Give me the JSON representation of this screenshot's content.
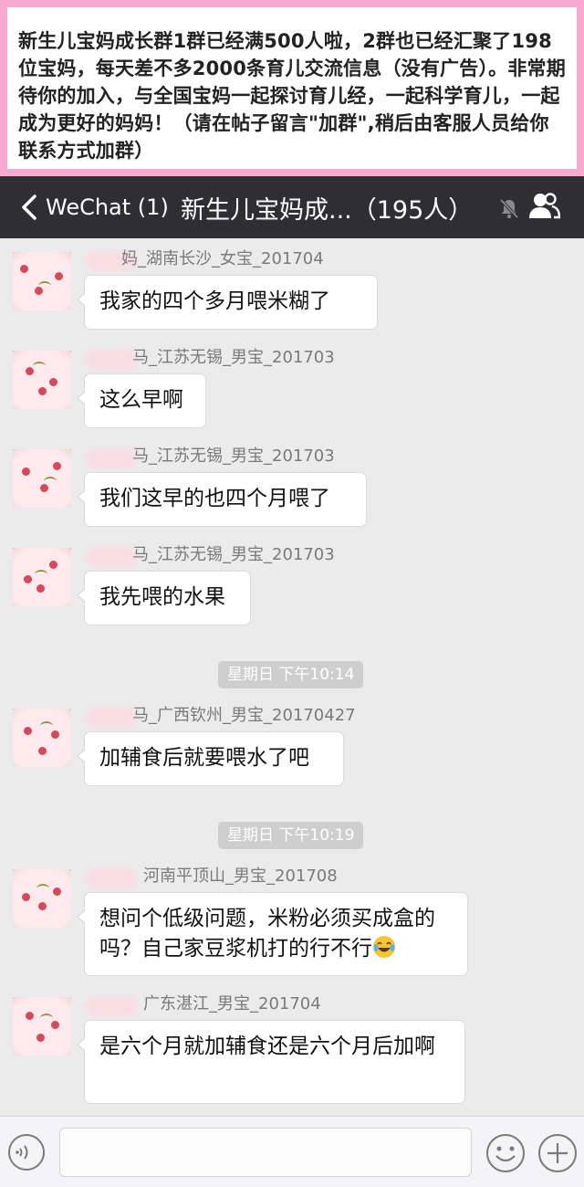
{
  "banner": {
    "text": "新生儿宝妈成长群1群已经满500人啦，2群也已经汇聚了198位宝妈，每天差不多2000条育儿交流信息（没有广告）。非常期待你的加入，与全国宝妈一起探讨育儿经，一起科学育儿，一起成为更好的妈妈！（请在帖子留言\"加群\",稍后由客服人员给你联系方式加群）"
  },
  "navbar": {
    "back_label": "WeChat (1)",
    "title": "新生儿宝妈成...（195人）",
    "mute_icon": "mute-bell-icon",
    "members_icon": "members-icon",
    "background": "#2f2f33"
  },
  "chat": {
    "messages": [
      {
        "sender": "妈_湖南长沙_女宝_201704",
        "text": "我家的四个多月喂米糊了"
      },
      {
        "sender": "马_江苏无锡_男宝_201703",
        "text": "这么早啊"
      },
      {
        "sender": "马_江苏无锡_男宝_201703",
        "text": "我们这早的也四个月喂了"
      },
      {
        "sender": "马_江苏无锡_男宝_201703",
        "text": "我先喂的水果"
      },
      {
        "sender": "马_广西钦州_男宝_20170427",
        "text": "加辅食后就要喂水了吧"
      },
      {
        "sender": "河南平顶山_男宝_201708",
        "text": "想问个低级问题，米粉必须买成盒的吗？自己家豆浆机打的行不行",
        "emoji": "tears-of-joy-emoji"
      },
      {
        "sender": "广东湛江_男宝_201704",
        "text": " 是六个月就加辅食还是六个月后加啊"
      }
    ],
    "timestamps": [
      "星期日 下午10:14",
      "星期日 下午10:19"
    ],
    "background": "#ebebeb"
  },
  "inputbar": {
    "voice_icon": "voice-icon",
    "emoji_icon": "emoji-icon",
    "plus_icon": "plus-icon",
    "input_value": ""
  }
}
